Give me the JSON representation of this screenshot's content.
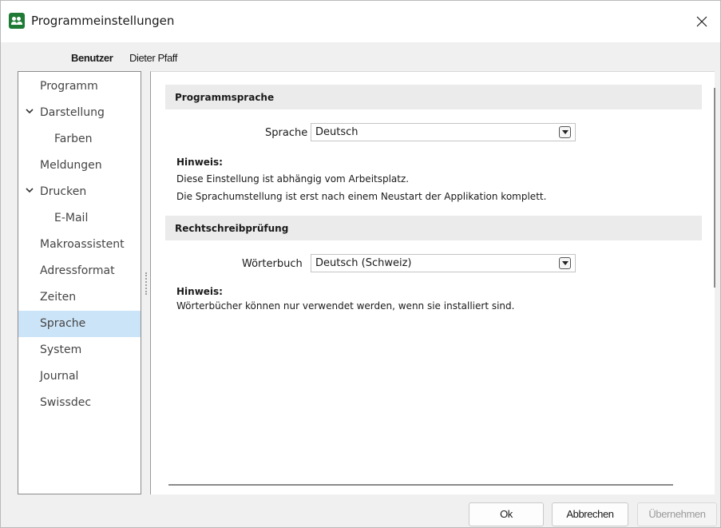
{
  "window": {
    "title": "Programmeinstellungen",
    "icon": "users-app-icon",
    "close_glyph": "×"
  },
  "user": {
    "label": "Benutzer",
    "name": "Dieter Pfaff"
  },
  "nav": {
    "items": [
      {
        "label": "Programm",
        "level": 0,
        "expander": false,
        "selected": false
      },
      {
        "label": "Darstellung",
        "level": 0,
        "expander": true,
        "selected": false
      },
      {
        "label": "Farben",
        "level": 1,
        "expander": false,
        "selected": false
      },
      {
        "label": "Meldungen",
        "level": 0,
        "expander": false,
        "selected": false
      },
      {
        "label": "Drucken",
        "level": 0,
        "expander": true,
        "selected": false
      },
      {
        "label": "E-Mail",
        "level": 1,
        "expander": false,
        "selected": false
      },
      {
        "label": "Makroassistent",
        "level": 0,
        "expander": false,
        "selected": false
      },
      {
        "label": "Adressformat",
        "level": 0,
        "expander": false,
        "selected": false
      },
      {
        "label": "Zeiten",
        "level": 0,
        "expander": false,
        "selected": false
      },
      {
        "label": "Sprache",
        "level": 0,
        "expander": false,
        "selected": true
      },
      {
        "label": "System",
        "level": 0,
        "expander": false,
        "selected": false
      },
      {
        "label": "Journal",
        "level": 0,
        "expander": false,
        "selected": false
      },
      {
        "label": "Swissdec",
        "level": 0,
        "expander": false,
        "selected": false
      }
    ]
  },
  "sections": {
    "language": {
      "title": "Programmsprache",
      "field_label": "Sprache",
      "value": "Deutsch",
      "hint_title": "Hinweis:",
      "hint_lines": [
        "Diese Einstellung ist abhängig vom Arbeitsplatz.",
        "Die Sprachumstellung ist erst nach einem Neustart der Applikation komplett."
      ]
    },
    "spelling": {
      "title": "Rechtschreibprüfung",
      "field_label": "Wörterbuch",
      "value": "Deutsch (Schweiz)",
      "hint_title": "Hinweis:",
      "hint_lines": [
        "Wörterbücher können nur verwendet werden, wenn sie installiert sind."
      ]
    }
  },
  "buttons": {
    "ok": "Ok",
    "cancel": "Abbrechen",
    "apply": "Übernehmen"
  },
  "colors": {
    "selection": "#cce4f7",
    "section_header": "#ebebeb",
    "app_icon": "#1f7a36"
  }
}
